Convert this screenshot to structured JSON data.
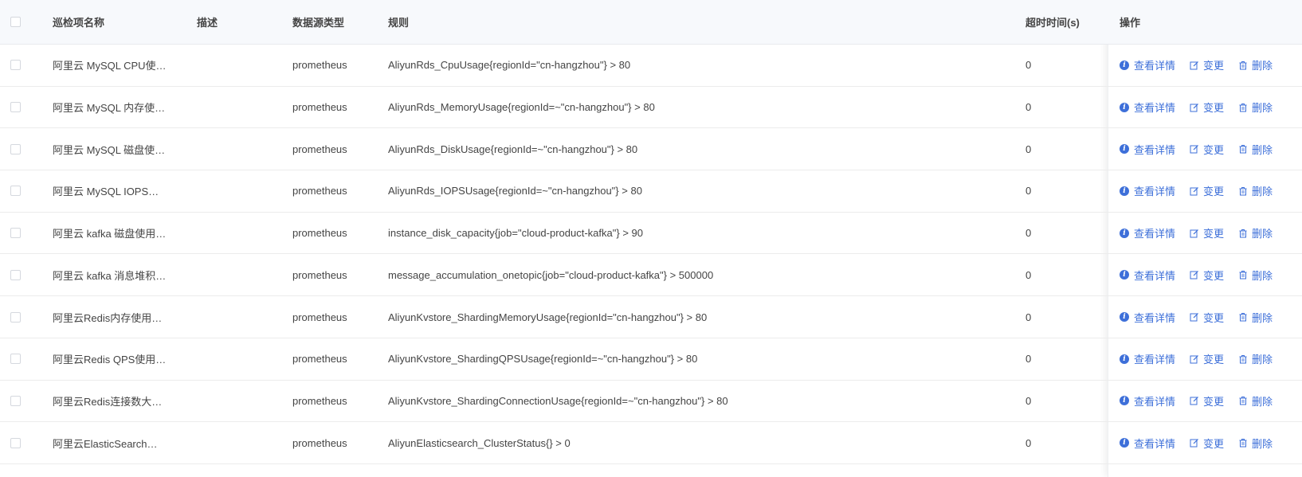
{
  "columns": {
    "name": "巡检项名称",
    "desc": "描述",
    "source": "数据源类型",
    "rule": "规则",
    "timeout": "超时时间(s)",
    "ops": "操作"
  },
  "ops_labels": {
    "view": "查看详情",
    "edit": "变更",
    "delete": "删除"
  },
  "colors": {
    "link": "#3d6fd9",
    "header_bg": "#f7f9fc"
  },
  "rows": [
    {
      "name": "阿里云 MySQL CPU使…",
      "desc": "",
      "source": "prometheus",
      "rule": "AliyunRds_CpuUsage{regionId=\"cn-hangzhou\"} > 80",
      "timeout": "0"
    },
    {
      "name": "阿里云 MySQL 内存使…",
      "desc": "",
      "source": "prometheus",
      "rule": "AliyunRds_MemoryUsage{regionId=~\"cn-hangzhou\"} > 80",
      "timeout": "0"
    },
    {
      "name": "阿里云 MySQL 磁盘使…",
      "desc": "",
      "source": "prometheus",
      "rule": "AliyunRds_DiskUsage{regionId=~\"cn-hangzhou\"} > 80",
      "timeout": "0"
    },
    {
      "name": "阿里云 MySQL IOPS…",
      "desc": "",
      "source": "prometheus",
      "rule": "AliyunRds_IOPSUsage{regionId=~\"cn-hangzhou\"} > 80",
      "timeout": "0"
    },
    {
      "name": "阿里云 kafka 磁盘使用…",
      "desc": "",
      "source": "prometheus",
      "rule": "instance_disk_capacity{job=\"cloud-product-kafka\"} > 90",
      "timeout": "0"
    },
    {
      "name": "阿里云 kafka 消息堆积…",
      "desc": "",
      "source": "prometheus",
      "rule": "message_accumulation_onetopic{job=\"cloud-product-kafka\"} > 500000",
      "timeout": "0"
    },
    {
      "name": "阿里云Redis内存使用…",
      "desc": "",
      "source": "prometheus",
      "rule": "AliyunKvstore_ShardingMemoryUsage{regionId=\"cn-hangzhou\"} > 80",
      "timeout": "0"
    },
    {
      "name": "阿里云Redis QPS使用…",
      "desc": "",
      "source": "prometheus",
      "rule": "AliyunKvstore_ShardingQPSUsage{regionId=~\"cn-hangzhou\"} > 80",
      "timeout": "0"
    },
    {
      "name": "阿里云Redis连接数大…",
      "desc": "",
      "source": "prometheus",
      "rule": "AliyunKvstore_ShardingConnectionUsage{regionId=~\"cn-hangzhou\"} > 80",
      "timeout": "0"
    },
    {
      "name": "阿里云ElasticSearch…",
      "desc": "",
      "source": "prometheus",
      "rule": "AliyunElasticsearch_ClusterStatus{} > 0",
      "timeout": "0"
    }
  ]
}
